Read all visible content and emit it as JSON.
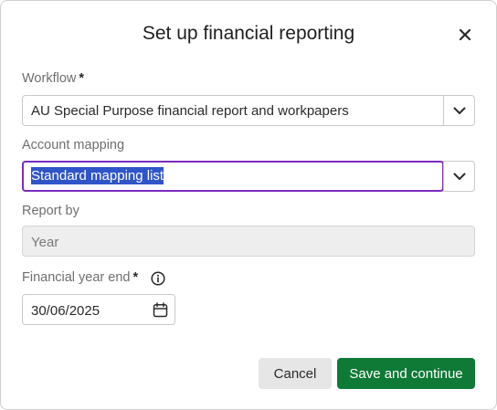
{
  "dialog": {
    "title": "Set up financial reporting",
    "close_icon": "close-icon"
  },
  "workflow": {
    "label": "Workflow",
    "required_marker": "*",
    "value": "AU Special Purpose financial report and workpapers",
    "dropdown_icon": "chevron-down-icon"
  },
  "account_mapping": {
    "label": "Account mapping",
    "value": "Standard mapping list",
    "selected": true,
    "dropdown_icon": "chevron-down-icon"
  },
  "report_by": {
    "label": "Report by",
    "value": "Year",
    "disabled": true
  },
  "financial_year_end": {
    "label": "Financial year end",
    "required_marker": "*",
    "info_icon": "info-icon",
    "value": "30/06/2025",
    "calendar_icon": "calendar-icon"
  },
  "actions": {
    "cancel_label": "Cancel",
    "save_label": "Save and continue"
  },
  "colors": {
    "primary_button": "#0f7a36",
    "focus_border": "#7b2cbf",
    "selection": "#2f55c8"
  }
}
